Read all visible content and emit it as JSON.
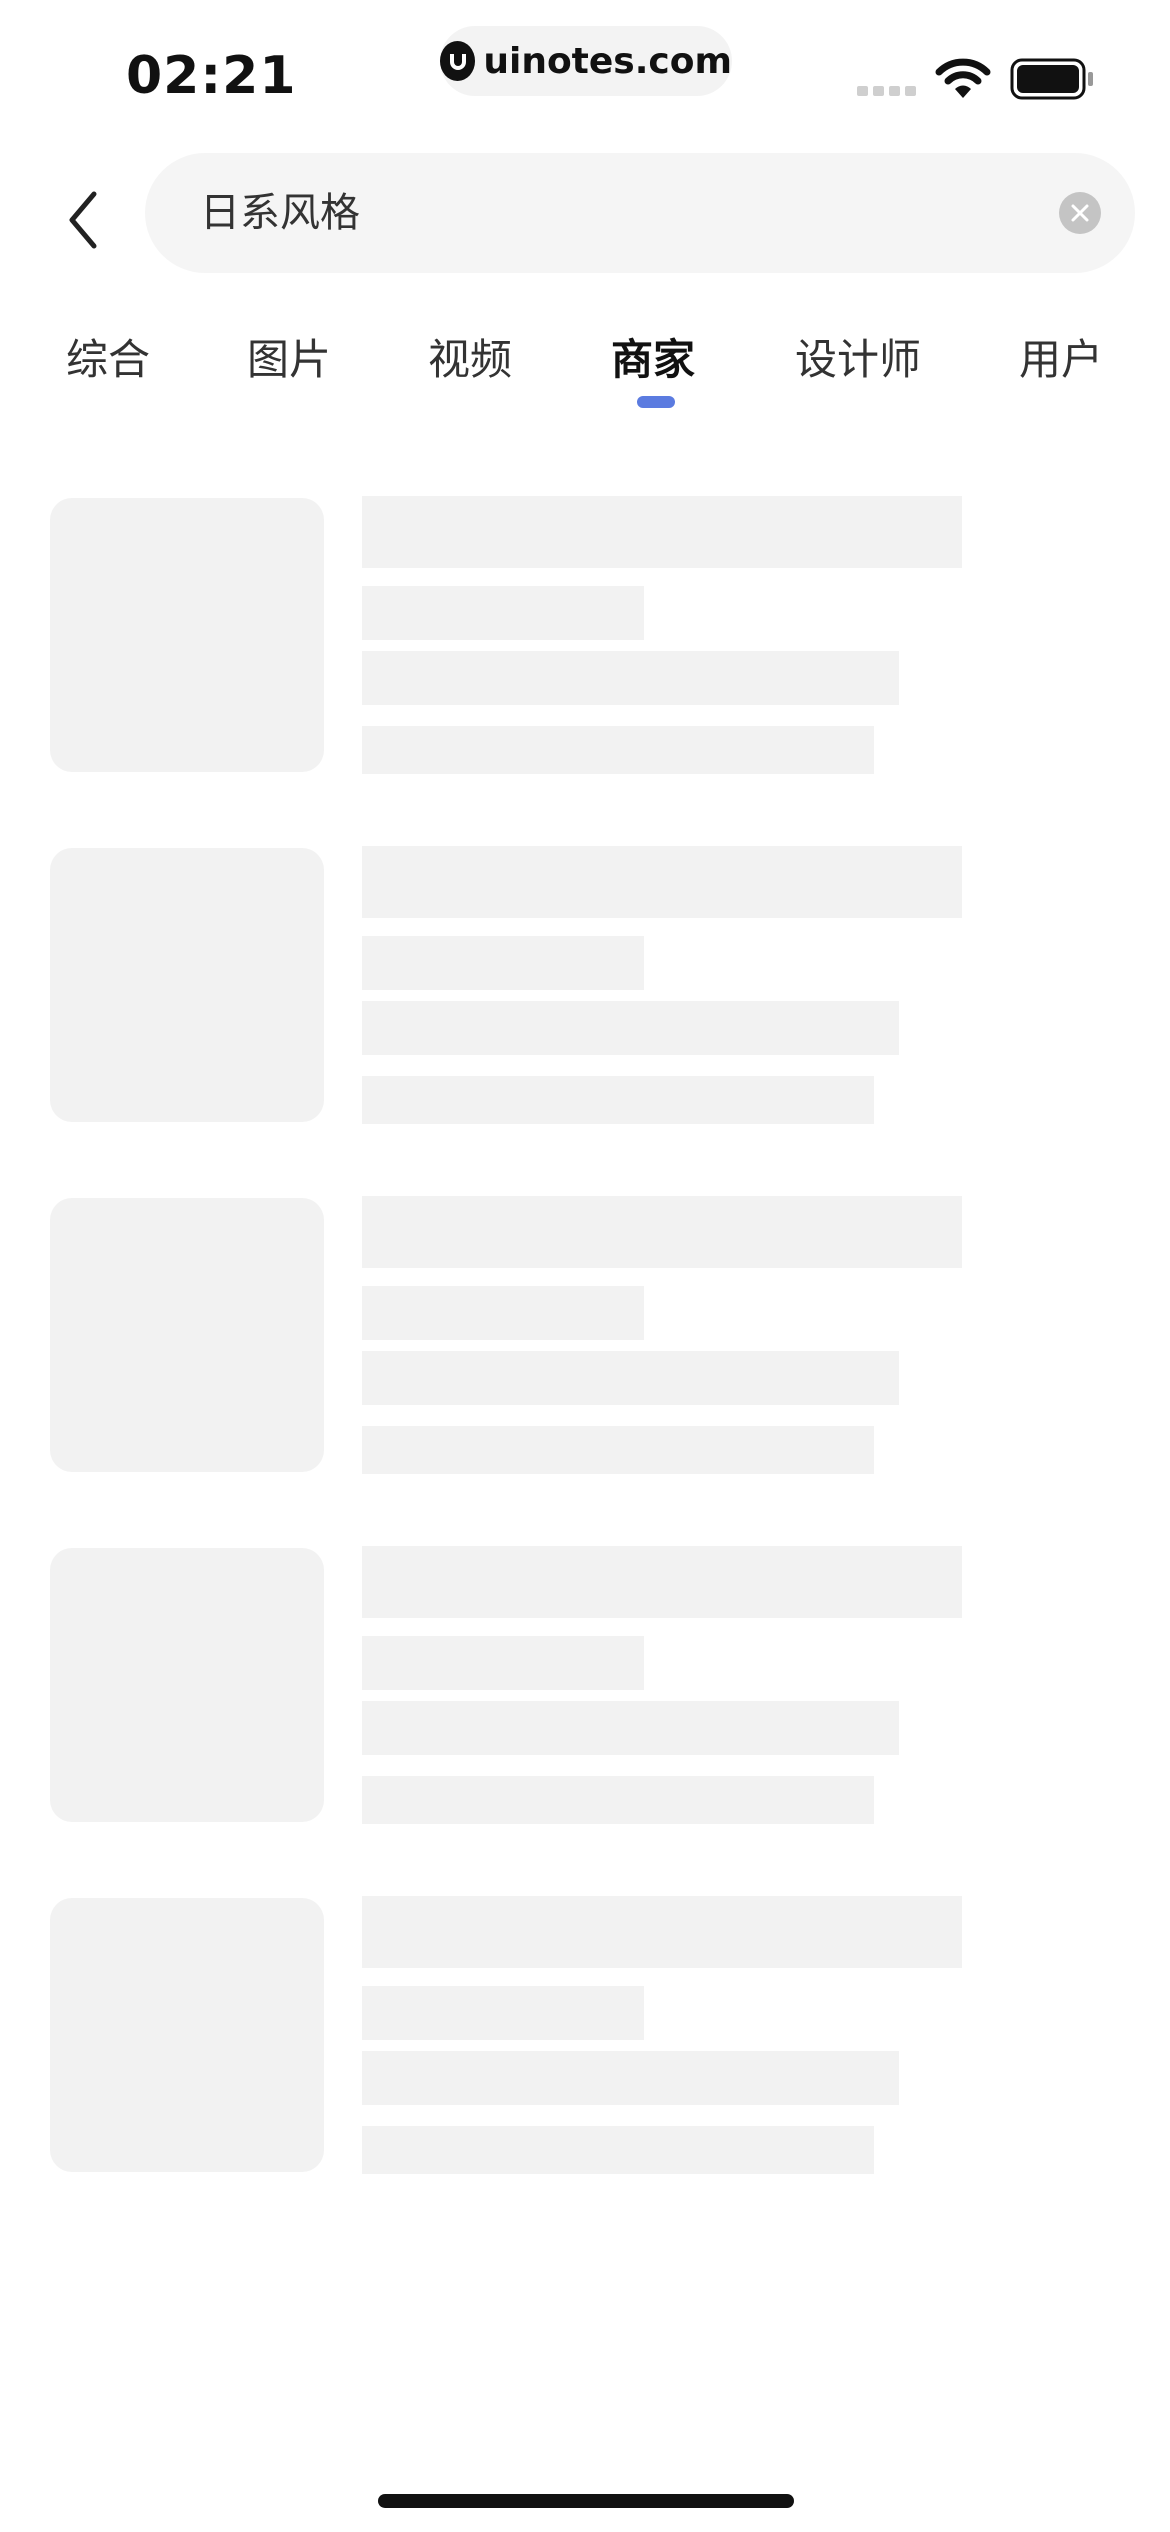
{
  "status_bar": {
    "time": "02:21",
    "watermark": "uinotes.com"
  },
  "search": {
    "back_icon": "chevron-left-icon",
    "query": "日系风格",
    "clear_icon": "close-circle-icon"
  },
  "tabs": [
    {
      "label": "综合",
      "active": false
    },
    {
      "label": "图片",
      "active": false
    },
    {
      "label": "视频",
      "active": false
    },
    {
      "label": "商家",
      "active": true
    },
    {
      "label": "设计师",
      "active": false
    },
    {
      "label": "用户",
      "active": false
    }
  ],
  "colors": {
    "accent": "#5b7be0",
    "skeleton": "#f2f2f2",
    "search_bg": "#f5f5f5"
  },
  "results": {
    "state": "loading",
    "placeholder_count": 5
  }
}
